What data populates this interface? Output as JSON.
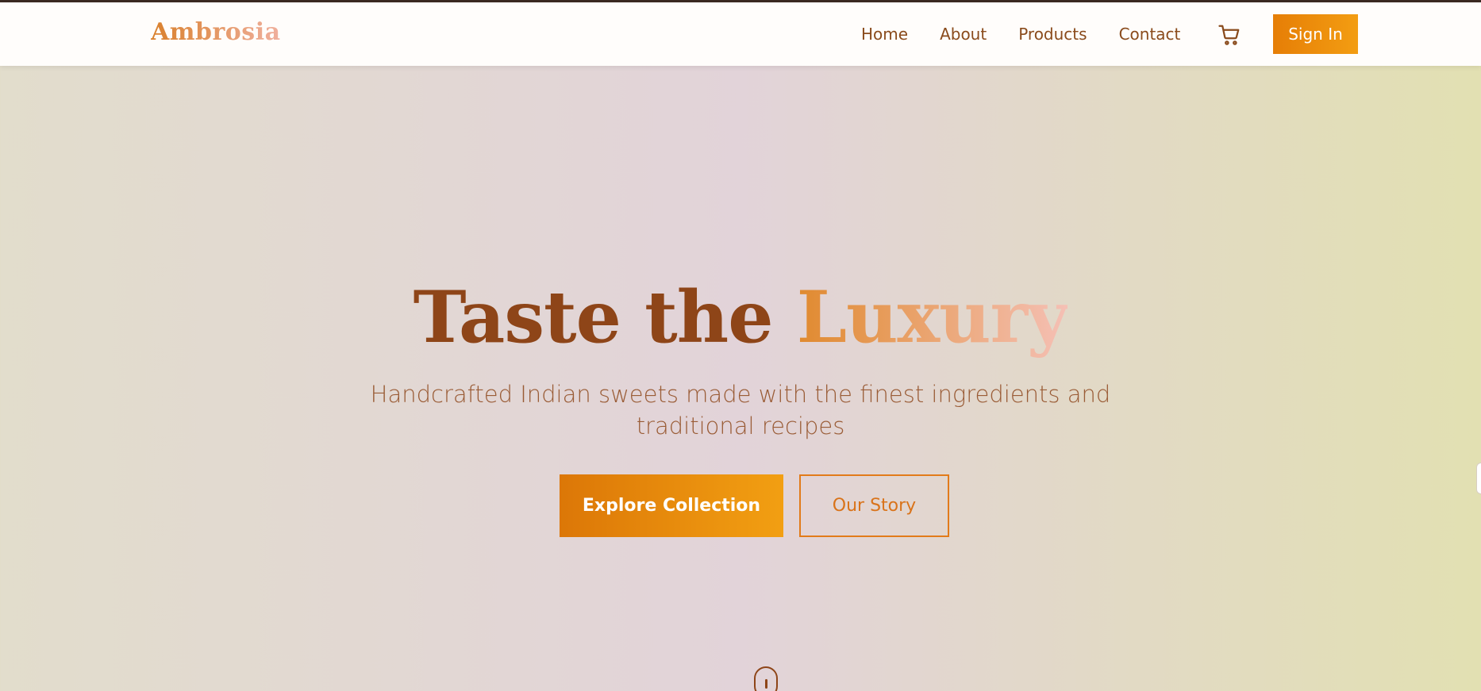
{
  "brand": {
    "name": "Ambrosia"
  },
  "nav": {
    "items": [
      {
        "label": "Home"
      },
      {
        "label": "About"
      },
      {
        "label": "Products"
      },
      {
        "label": "Contact"
      }
    ],
    "cart_icon": "shopping-cart-icon",
    "signin_label": "Sign In"
  },
  "hero": {
    "title_main": "Taste the",
    "title_accent": "Luxury",
    "subtitle": "Handcrafted Indian sweets made with the finest ingredients and traditional recipes",
    "primary_cta": "Explore Collection",
    "secondary_cta": "Our Story",
    "scroll_icon": "mouse-scroll-icon"
  },
  "colors": {
    "brand_dark": "#8e4518",
    "accent_orange": "#e67e06",
    "nav_text": "#8a4b1c"
  }
}
